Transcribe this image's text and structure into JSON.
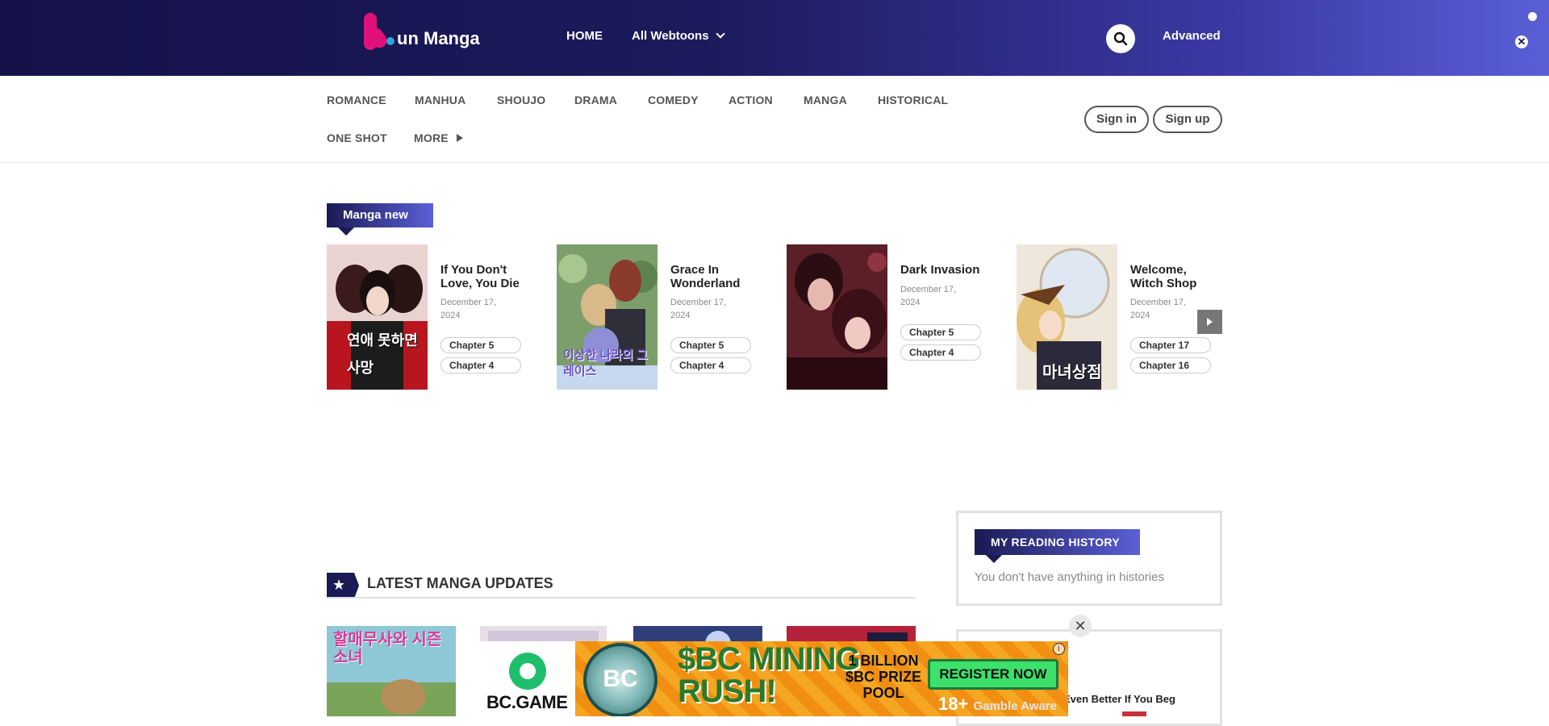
{
  "header": {
    "logo_text": "un Manga",
    "nav": {
      "home": "HOME",
      "all_webtoons": "All Webtoons",
      "advanced": "Advanced"
    }
  },
  "genres": {
    "row1": [
      "ROMANCE",
      "MANHUA",
      "SHOUJO",
      "DRAMA",
      "COMEDY",
      "ACTION",
      "MANGA",
      "HISTORICAL"
    ],
    "one_shot": "ONE SHOT",
    "more": "MORE"
  },
  "auth": {
    "sign_in": "Sign in",
    "sign_up": "Sign up"
  },
  "manga_new": {
    "label": "Manga new",
    "items": [
      {
        "title_l1": "If You Don't",
        "title_l2": "Love, You Die",
        "date_l1": "December 17,",
        "date_l2": "2024",
        "chapters": [
          "Chapter 5",
          "Chapter 4"
        ],
        "cover_text": "연애 못하면 사망"
      },
      {
        "title_l1": "Grace In",
        "title_l2": "Wonderland",
        "date_l1": "December 17,",
        "date_l2": "2024",
        "chapters": [
          "Chapter 5",
          "Chapter 4"
        ],
        "cover_text": "이상한 나라의 그레이스"
      },
      {
        "title_l1": "Dark Invasion",
        "title_l2": "",
        "date_l1": "December 17,",
        "date_l2": "2024",
        "chapters": [
          "Chapter 5",
          "Chapter 4"
        ],
        "cover_text": ""
      },
      {
        "title_l1": "Welcome,",
        "title_l2": "Witch Shop",
        "date_l1": "December 17,",
        "date_l2": "2024",
        "chapters": [
          "Chapter 17",
          "Chapter 16"
        ],
        "cover_text": "마녀상점"
      }
    ]
  },
  "latest": {
    "title": "LATEST MANGA UPDATES",
    "star": "★",
    "thumb1_text": "할매무사와 시즌소녀"
  },
  "reading_history": {
    "title": "MY READING HISTORY",
    "empty": "You don't have anything in histories"
  },
  "popular": {
    "partial_title": "Even Better If You Beg"
  },
  "ad": {
    "close": "✕",
    "brand": "BC.GAME",
    "coin": "BC",
    "headline_l1": "$BC MINING",
    "headline_l2": "RUSH!",
    "prize_l1": "1 BILLION",
    "prize_l2": "$BC PRIZE",
    "prize_l3": "POOL",
    "register": "REGISTER NOW",
    "age": "18+",
    "gamble": "Gamble Aware",
    "info": "i"
  },
  "colors": {
    "header_start": "#15124a",
    "header_end": "#5a5fd6",
    "accent_navy": "#1b1a55",
    "ad_orange": "#f29a1a"
  }
}
